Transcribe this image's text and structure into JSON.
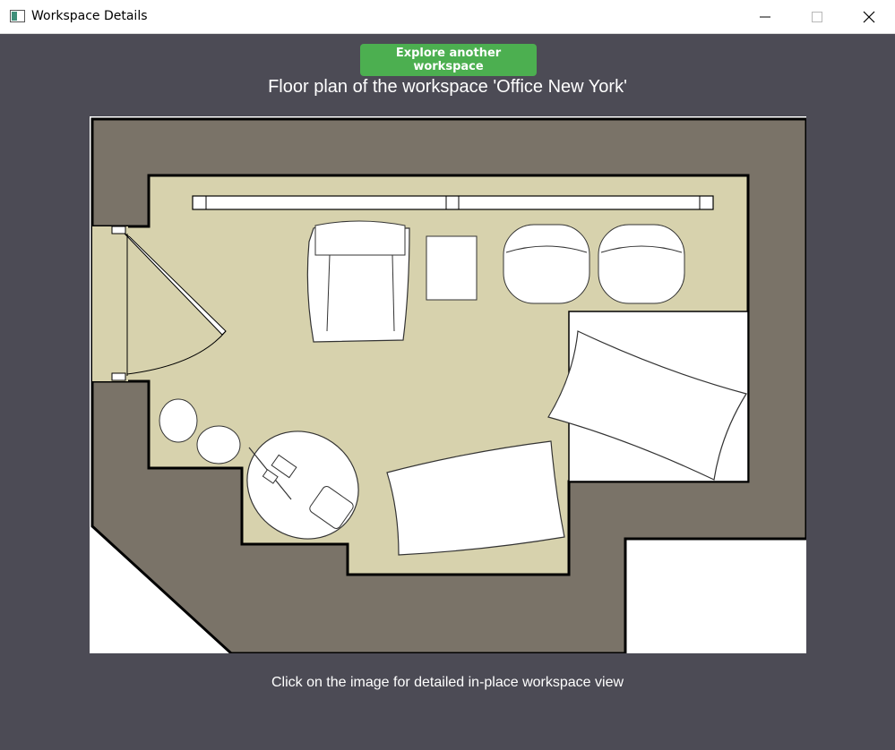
{
  "window": {
    "title": "Workspace Details",
    "icon": "app-window-icon",
    "controls": [
      "minimize-icon",
      "maximize-icon",
      "close-icon"
    ]
  },
  "toolbar": {
    "explore_label": "Explore another workspace",
    "explore_color": "#4caf50"
  },
  "main": {
    "caption": "Floor plan of the workspace 'Office New York'",
    "image": {
      "wall_color": "#7a7368",
      "floor_color": "#d7d2ad",
      "background": "#4c4b55"
    },
    "hint": "Click on the image for detailed in-place workspace view"
  }
}
